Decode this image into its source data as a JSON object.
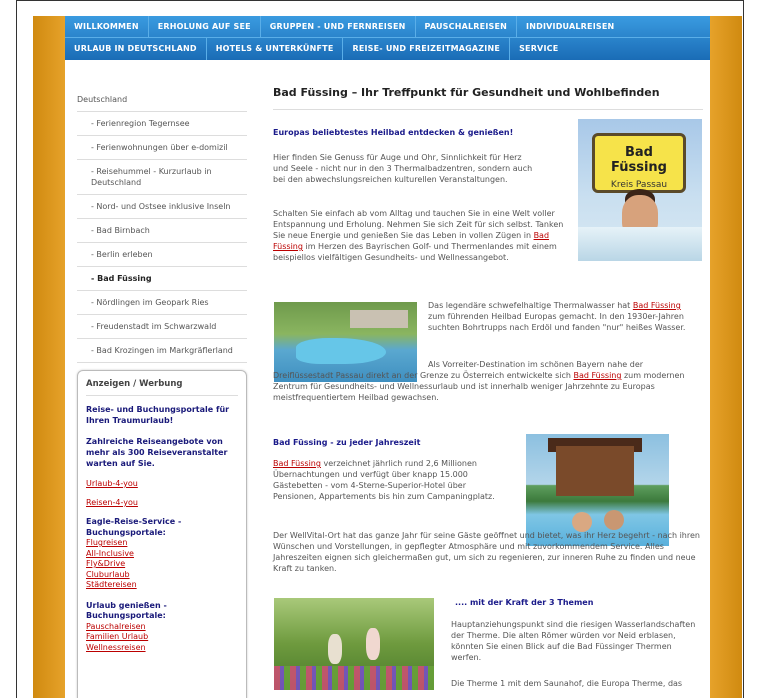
{
  "nav": {
    "row1": [
      "WILLKOMMEN",
      "ERHOLUNG AUF SEE",
      "GRUPPEN - UND FERNREISEN",
      "PAUSCHALREISEN",
      "INDIVIDUALREISEN"
    ],
    "row2": [
      "URLAUB IN DEUTSCHLAND",
      "HOTELS & UNTERKÜNFTE",
      "REISE- UND FREIZEITMAGAZINE",
      "SERVICE"
    ]
  },
  "sidebar": {
    "items": [
      "Deutschland",
      "- Ferienregion Tegernsee",
      "- Ferienwohnungen über e-domizil",
      "- Reisehummel - Kurzurlaub in Deutschland",
      "- Nord- und Ostsee inklusive Inseln",
      "- Bad Birnbach",
      "- Berlin erleben",
      "- Bad Füssing",
      "- Nördlingen im Geopark Ries",
      "- Freudenstadt im Schwarzwald",
      "- Bad Krozingen im Markgräflerland"
    ],
    "active_index": 7
  },
  "ads": {
    "title": "Anzeigen / Werbung",
    "strong1": "Reise- und Buchungsportale für Ihren Traumurlaub!",
    "strong2": "Zahlreiche Reiseangebote von mehr als 300 Reiseveranstalter warten auf Sie.",
    "link1": "Urlaub-4-you",
    "link2": "Reisen-4-you",
    "group1_title": "Eagle-Reise-Service - Buchungsportale:",
    "group1_links": [
      "Flugreisen",
      "All-Inclusive",
      "Fly&Drive",
      "Cluburlaub",
      "Städtereisen"
    ],
    "group2_title": "Urlaub genießen - Buchungsportale:",
    "group2_links": [
      "Pauschalreisen",
      "Familien Urlaub",
      "Wellnessreisen"
    ]
  },
  "main": {
    "title": "Bad Füssing – Ihr Treffpunkt für Gesundheit und Wohlbefinden",
    "s1_heading": "Europas beliebtestes Heilbad entdecken & genießen!",
    "s1_p1": "Hier finden Sie Genuss für Auge und Ohr, Sinnlichkeit für Herz und Seele - nicht nur in den 3 Thermalbadzentren, sondern auch bei den abwechslungsreichen kulturellen Veranstaltungen.",
    "s1_p2a": "Schalten Sie einfach ab vom Alltag und tauchen Sie in eine Welt voller Entspannung und Erholung. Nehmen Sie sich Zeit für sich selbst. Tanken Sie neue Energie und genießen Sie das Leben in vollen Zügen in ",
    "s1_link": "Bad Füssing",
    "s1_p2b": " im Herzen des Bayrischen Golf- und Thermenlandes mit einem beispiellos vielfältigen Gesundheits- und Wellnessangebot.",
    "s2_p1a": "Das legendäre schwefelhaltige Thermalwasser hat ",
    "s2_link1": "Bad Füssing",
    "s2_p1b": " zum führenden Heilbad Europas gemacht. In den 1930er-Jahren suchten Bohrtrupps nach Erdöl und fanden \"nur\" heißes Wasser.",
    "s2_p2a": "Als Vorreiter-Destination im schönen Bayern nahe der Dreiflüssestadt Passau direkt an der Grenze zu Österreich entwickelte sich ",
    "s2_link2": "Bad Füssing",
    "s2_p2b": " zum modernen Zentrum für Gesundheits- und Wellnessurlaub und ist innerhalb weniger Jahrzehnte zu Europas meistfrequentiertem Heilbad gewachsen.",
    "s3_heading": "Bad Füssing - zu jeder Jahreszeit",
    "s3_link": "Bad Füssing",
    "s3_p1": " verzeichnet jährlich rund 2,6 Millionen Übernachtungen und verfügt über knapp 15.000 Gästebetten - vom 4-Sterne-Superior-Hotel über Pensionen, Appartements bis hin zum Campaningplatz.",
    "s3_p2": "Der WellVital-Ort hat das ganze Jahr für seine Gäste geöffnet und bietet, was ihr Herz begehrt - nach ihren Wünschen und Vorstellungen, in gepflegter Atmosphäre und mit zuvorkommendem Service. Alles Jahreszeiten eignen sich gleichermaßen gut, um sich zu regenieren, zur inneren Ruhe zu finden und neue Kraft zu tanken.",
    "s4_heading": ".... mit der Kraft der 3 Themen",
    "s4_p1": "Hauptanziehungspunkt sind die riesigen Wasserlandschaften der Therme. Die alten Römer würden vor Neid erblasen, könnten Sie einen Blick auf die Bad Füssinger Thermen werfen.",
    "s4_p2": "Die Therme 1 mit dem Saunahof, die Europa Therme, das"
  },
  "sign": {
    "title": "Bad Füssing",
    "subtitle": "Kreis Passau"
  }
}
